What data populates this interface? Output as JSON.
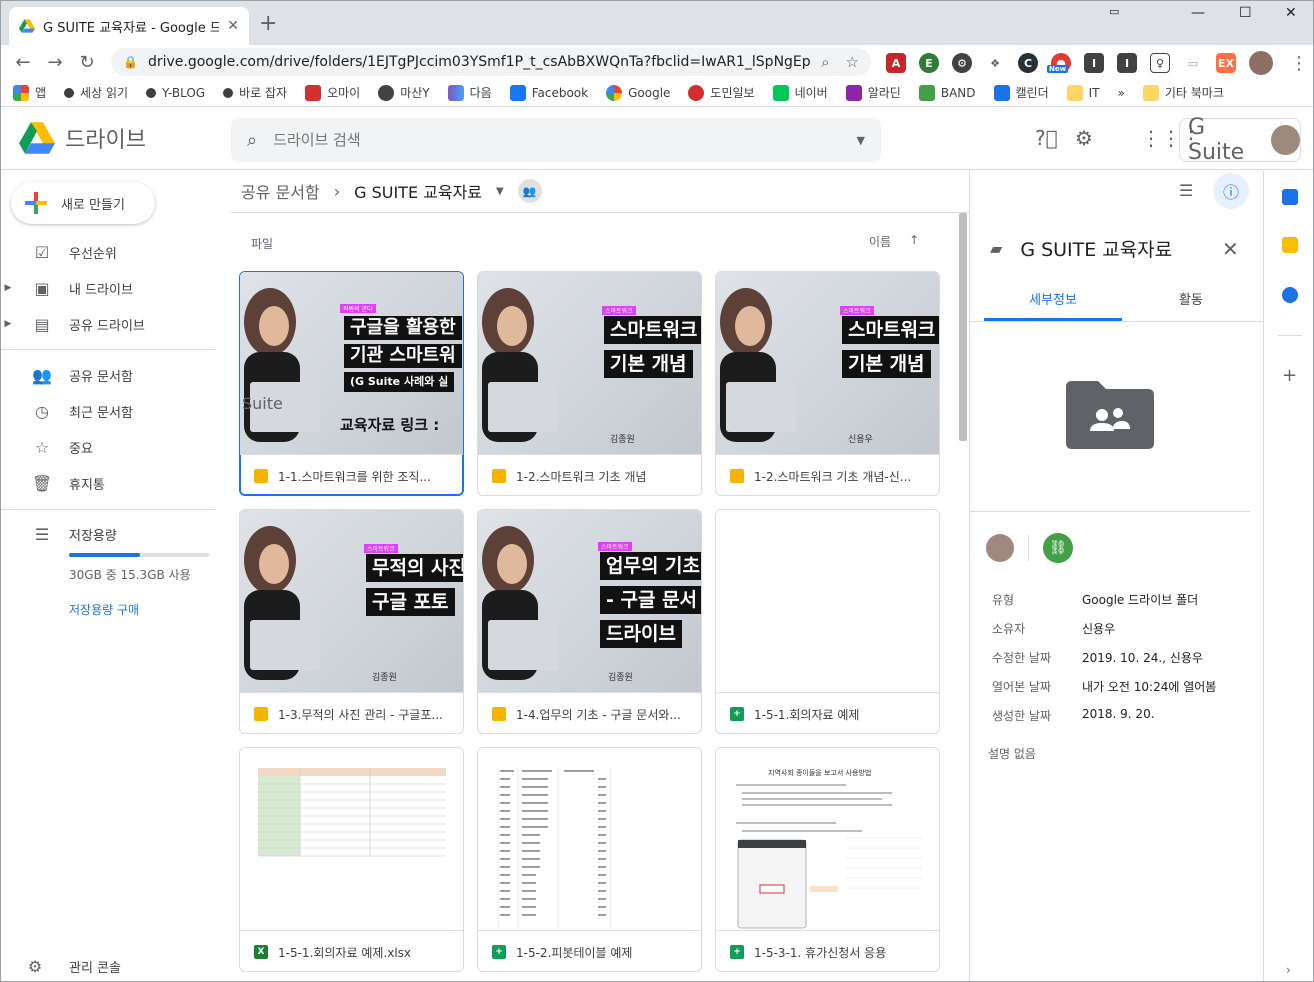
{
  "browser": {
    "tab_title": "G SUITE 교육자료 - Google 드",
    "new_tab": "+",
    "url": "drive.google.com/drive/folders/1EJTgPJccim03YSmf1P_t_csAbBXWQnTa?fbclid=IwAR1_lSpNgEpWI9SYr...",
    "ext_badge_new": "New",
    "bookmarks": [
      "앱",
      "세상 읽기",
      "Y-BLOG",
      "바로 잡자",
      "오마이",
      "마산Y",
      "다음",
      "Facebook",
      "Google",
      "도민일보",
      "네이버",
      "알라딘",
      "BAND",
      "캘린더",
      "IT",
      "»",
      "기타 북마크"
    ]
  },
  "drive": {
    "brand": "드라이브",
    "search_placeholder": "드라이브 검색",
    "gsuite_label": "G Suite",
    "new_button": "새로 만들기",
    "nav": [
      "우선순위",
      "내 드라이브",
      "공유 드라이브",
      "공유 문서함",
      "최근 문서함",
      "중요",
      "휴지통"
    ],
    "storage_label": "저장용량",
    "storage_used_fraction": 0.51,
    "storage_text": "30GB 중 15.3GB 사용",
    "storage_buy": "저장용량 구매",
    "admin_console": "관리 콘솔",
    "breadcrumb_root": "공유 문서함",
    "breadcrumb_current": "G SUITE 교육자료",
    "files_label": "파일",
    "sort_label": "이름",
    "files": [
      {
        "name": "1-1.스마트워크를 위한 조직...",
        "type": "slides"
      },
      {
        "name": "1-2.스마트워크 기초 개념",
        "type": "slides"
      },
      {
        "name": "1-2.스마트워크 기초 개념-신...",
        "type": "slides"
      },
      {
        "name": "1-3.무적의 사진 관리 - 구글포...",
        "type": "slides"
      },
      {
        "name": "1-4.업무의 기초 - 구글 문서와...",
        "type": "slides"
      },
      {
        "name": "1-5-1.회의자료 예제",
        "type": "sheets"
      },
      {
        "name": "1-5-1.회의자료 예제.xlsx",
        "type": "excel"
      },
      {
        "name": "1-5-2.피봇테이블 예제",
        "type": "sheets"
      },
      {
        "name": "1-5-3-1. 휴가신청서 응용",
        "type": "sheets"
      }
    ],
    "thumbs": {
      "t1": {
        "tag": "직원의 관다",
        "line1": "구글을 활용한",
        "line2": "기관 스마트워",
        "line3": "(G Suite 사례와 실",
        "line4": "교육자료 링크 :",
        "side": "Suite"
      },
      "t2": {
        "tag": "스마트워크",
        "line1": "스마트워크",
        "line2": "기본 개념",
        "author": "김종원"
      },
      "t3": {
        "tag": "스마트워크",
        "line1": "스마트워크",
        "line2": "기본 개념",
        "author": "신용우"
      },
      "t4": {
        "tag": "스마트워크",
        "line1": "무적의 사진",
        "line2": "구글 포토",
        "author": "김종원"
      },
      "t5": {
        "tag": "스마트워크",
        "line1": "업무의 기초",
        "line2": "- 구글 문서",
        "line3": "드라이브",
        "author": "김종원"
      },
      "t9": {
        "heading": "지역사회 종이들을 보고서 사용방법"
      }
    },
    "details": {
      "title": "G SUITE 교육자료",
      "tab_details": "세부정보",
      "tab_activity": "활동",
      "rows": [
        {
          "k": "유형",
          "v": "Google 드라이브 폴더"
        },
        {
          "k": "소유자",
          "v": "신용우"
        },
        {
          "k": "수정한 날짜",
          "v": "2019. 10. 24., 신용우"
        },
        {
          "k": "열어본 날짜",
          "v": "내가 오전 10:24에 열어봄"
        },
        {
          "k": "생성한 날짜",
          "v": "2018. 9. 20."
        }
      ],
      "no_description": "설명 없음"
    }
  },
  "colors": {
    "accent": "#1a73e8",
    "slides": "#f4b400",
    "sheets": "#0f9d58",
    "excel": "#1e7e34",
    "tag": "#e040fb"
  }
}
